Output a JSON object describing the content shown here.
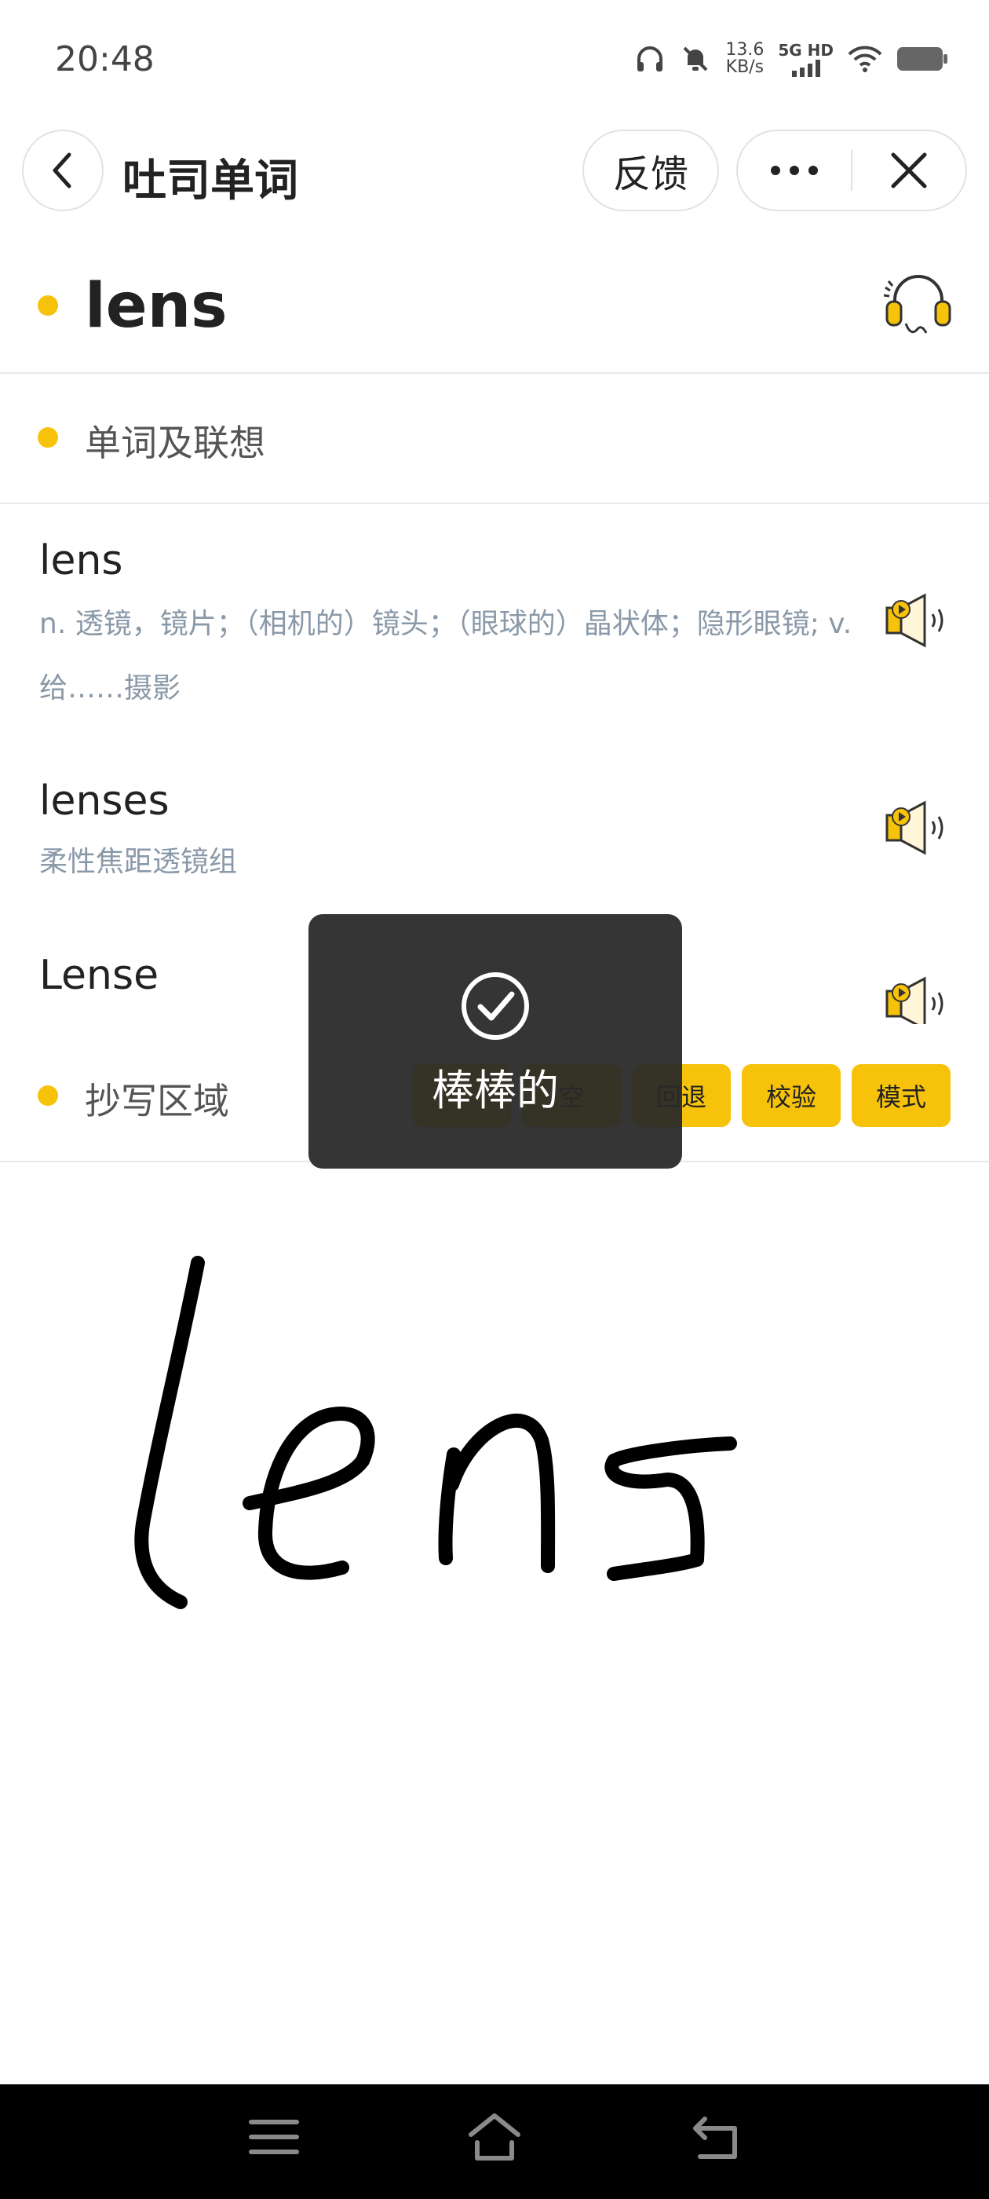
{
  "status_bar": {
    "time": "20:48",
    "net_speed_value": "13.6",
    "net_speed_unit": "KB/s",
    "network_type": "5G HD"
  },
  "header": {
    "title": "吐司单词",
    "feedback_label": "反馈"
  },
  "word": {
    "title": "lens"
  },
  "sections": {
    "related": "单词及联想",
    "copy_area": "抄写区域"
  },
  "entries": [
    {
      "word": "lens",
      "definition": "n. 透镜，镜片；（相机的）镜头；（眼球的）晶状体；隐形眼镜; v. 给……摄影"
    },
    {
      "word": "lenses",
      "definition": "柔性焦距透镜组"
    },
    {
      "word": "Lense",
      "definition": ""
    }
  ],
  "toolbar": {
    "clear_label": "空",
    "undo_label": "回退",
    "check_label": "校验",
    "mode_label": "模式"
  },
  "toast": {
    "message": "棒棒的"
  },
  "colors": {
    "accent": "#f7c20a",
    "toast_bg": "#282828",
    "navbar_bg": "#000000"
  },
  "icons": [
    "back-arrow-icon",
    "more-dots-icon",
    "close-icon",
    "headphones-icon",
    "speaker-icon",
    "checkmark-circle-icon",
    "menu-icon",
    "home-icon",
    "return-icon"
  ]
}
